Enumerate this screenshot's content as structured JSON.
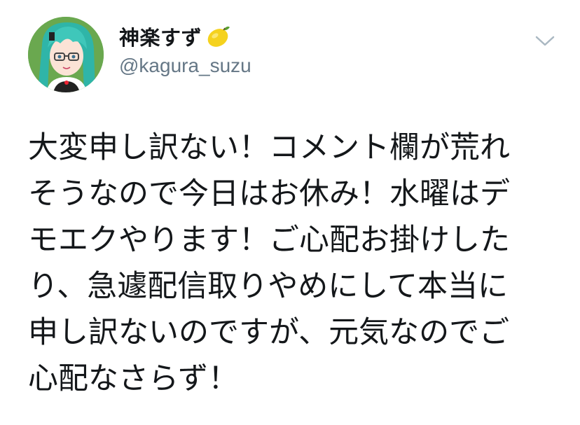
{
  "user": {
    "display_name": "神楽すず",
    "name_emoji": "lemon-icon",
    "handle": "@kagura_suzu"
  },
  "menu": {
    "icon": "chevron-down-icon"
  },
  "tweet": {
    "lines": [
      "大変申し訳ない！コメント欄が荒れ",
      "そうなので今日はお休み！水曜はデ",
      "モエクやります！ご心配お掛けした",
      "り、急遽配信取りやめにして本当に",
      "申し訳ないのですが、元気なのでご",
      "心配なさらず！"
    ]
  },
  "colors": {
    "text": "#14171a",
    "secondary": "#657786",
    "chevron": "#aab8c2",
    "avatar_bg": "#6aa84f",
    "hair": "#3fbfb3"
  }
}
